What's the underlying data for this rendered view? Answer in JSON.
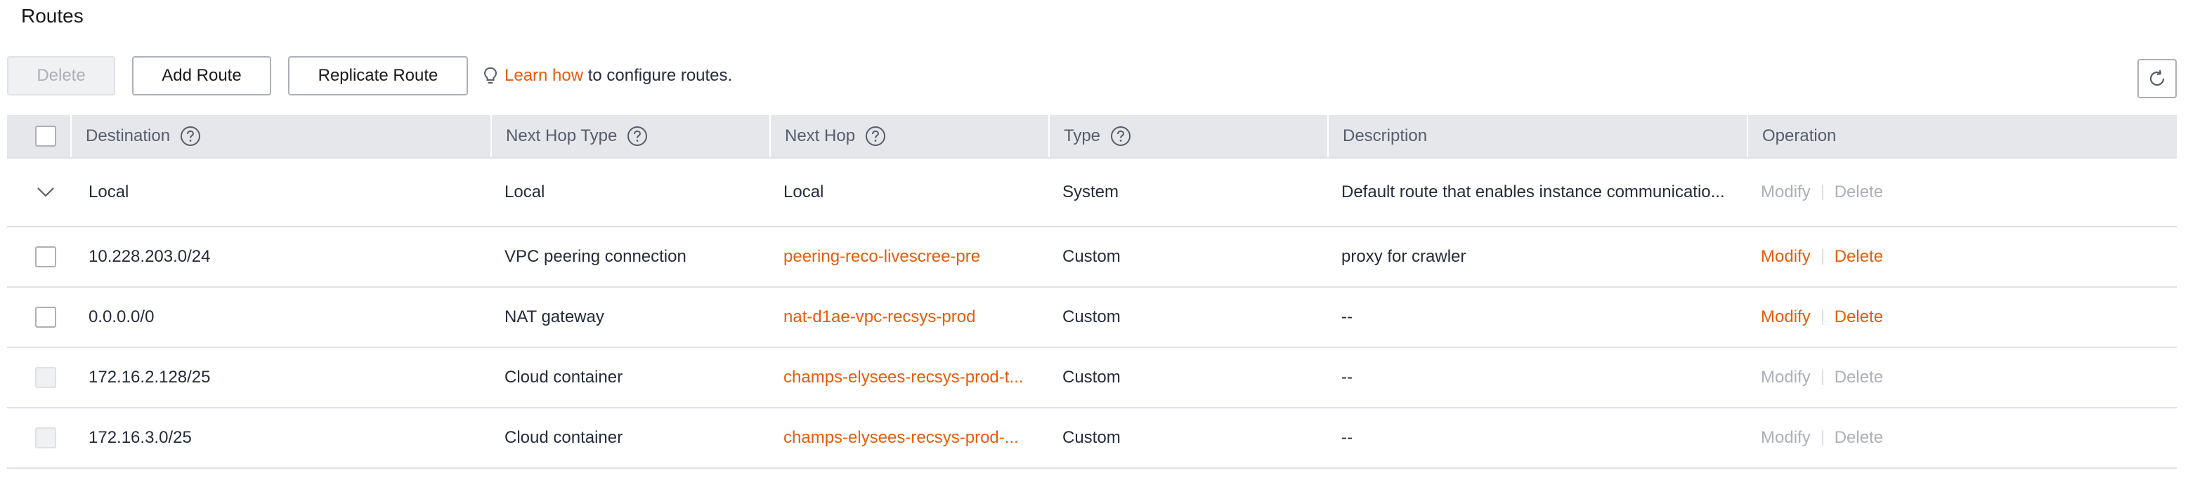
{
  "page": {
    "title": "Routes"
  },
  "toolbar": {
    "delete_label": "Delete",
    "add_route_label": "Add Route",
    "replicate_route_label": "Replicate Route",
    "tip_link": "Learn how",
    "tip_text": " to configure routes."
  },
  "icons": {
    "refresh": "refresh-icon",
    "help": "help-circle-icon",
    "bulb": "lightbulb-icon",
    "expand": "chevron-down-icon"
  },
  "colors": {
    "accent": "#e65c0c",
    "header_bg": "#e6e7ea",
    "disabled_text": "#adb0b8"
  },
  "table": {
    "columns": {
      "destination": "Destination",
      "next_hop_type": "Next Hop Type",
      "next_hop": "Next Hop",
      "type": "Type",
      "description": "Description",
      "operation": "Operation"
    },
    "rows": [
      {
        "destination": "Local",
        "next_hop_type": "Local",
        "next_hop": "Local",
        "type": "System",
        "description": "Default route that enables instance communicatio...",
        "modify": "Modify",
        "delete": "Delete"
      },
      {
        "destination": "10.228.203.0/24",
        "next_hop_type": "VPC peering connection",
        "next_hop": "peering-reco-livescree-pre",
        "type": "Custom",
        "description": "proxy for crawler",
        "modify": "Modify",
        "delete": "Delete"
      },
      {
        "destination": "0.0.0.0/0",
        "next_hop_type": "NAT gateway",
        "next_hop": "nat-d1ae-vpc-recsys-prod",
        "type": "Custom",
        "description": "--",
        "modify": "Modify",
        "delete": "Delete"
      },
      {
        "destination": "172.16.2.128/25",
        "next_hop_type": "Cloud container",
        "next_hop": "champs-elysees-recsys-prod-t...",
        "type": "Custom",
        "description": "--",
        "modify": "Modify",
        "delete": "Delete"
      },
      {
        "destination": "172.16.3.0/25",
        "next_hop_type": "Cloud container",
        "next_hop": "champs-elysees-recsys-prod-...",
        "type": "Custom",
        "description": "--",
        "modify": "Modify",
        "delete": "Delete"
      }
    ]
  }
}
